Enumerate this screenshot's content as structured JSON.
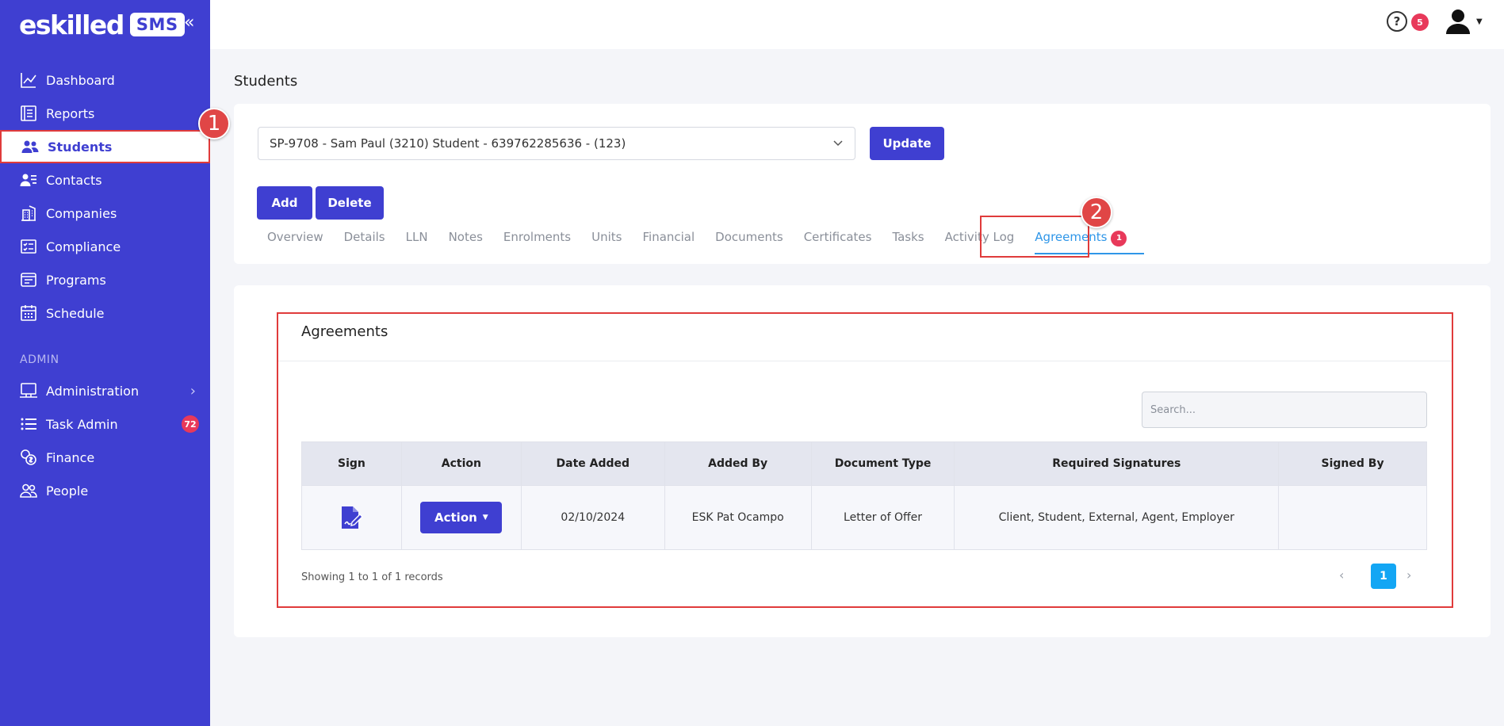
{
  "sidebar": {
    "logo_text": "eskilled",
    "logo_badge": "SMS",
    "collapse_glyph": "«",
    "items": [
      {
        "label": "Dashboard",
        "icon": "chart-line-icon"
      },
      {
        "label": "Reports",
        "icon": "reports-icon"
      },
      {
        "label": "Students",
        "icon": "users-icon",
        "active": true
      },
      {
        "label": "Contacts",
        "icon": "contacts-icon"
      },
      {
        "label": "Companies",
        "icon": "buildings-icon"
      },
      {
        "label": "Compliance",
        "icon": "checklist-icon"
      },
      {
        "label": "Programs",
        "icon": "window-icon"
      },
      {
        "label": "Schedule",
        "icon": "calendar-icon"
      }
    ],
    "section_label": "ADMIN",
    "admin_items": [
      {
        "label": "Administration",
        "icon": "monitor-icon",
        "chevron": "›"
      },
      {
        "label": "Task Admin",
        "icon": "list-icon",
        "badge": "72"
      },
      {
        "label": "Finance",
        "icon": "coins-icon"
      },
      {
        "label": "People",
        "icon": "people-icon"
      }
    ]
  },
  "callouts": {
    "first": "1",
    "second": "2"
  },
  "header": {
    "help_glyph": "?",
    "help_badge": "5"
  },
  "page": {
    "title": "Students"
  },
  "student_selector": {
    "value": "SP-9708 - Sam Paul (3210) Student - 639762285636 - (123)"
  },
  "buttons": {
    "update": "Update",
    "add": "Add",
    "delete": "Delete"
  },
  "tabs": [
    {
      "label": "Overview"
    },
    {
      "label": "Details"
    },
    {
      "label": "LLN"
    },
    {
      "label": "Notes"
    },
    {
      "label": "Enrolments"
    },
    {
      "label": "Units"
    },
    {
      "label": "Financial"
    },
    {
      "label": "Documents"
    },
    {
      "label": "Certificates"
    },
    {
      "label": "Tasks"
    },
    {
      "label": "Activity Log"
    },
    {
      "label": "Agreements",
      "badge": "1",
      "active": true
    }
  ],
  "agreements": {
    "title": "Agreements",
    "search_placeholder": "Search...",
    "columns": [
      "Sign",
      "Action",
      "Date Added",
      "Added By",
      "Document Type",
      "Required Signatures",
      "Signed By"
    ],
    "rows": [
      {
        "action_label": "Action",
        "date_added": "02/10/2024",
        "added_by": "ESK Pat Ocampo",
        "document_type": "Letter of Offer",
        "required_signatures": "Client, Student, External, Agent, Employer",
        "signed_by": ""
      }
    ],
    "records_info": "Showing 1 to 1 of 1 records",
    "pager": {
      "prev": "‹",
      "current": "1",
      "next": "›"
    }
  },
  "colors": {
    "sidebar": "#3f3fd1",
    "primary_button": "#3f3fd1",
    "active_tab": "#2f96e8",
    "badge": "#e8395a",
    "highlight_border": "#e03b3b",
    "pager_active": "#13a6f4"
  }
}
